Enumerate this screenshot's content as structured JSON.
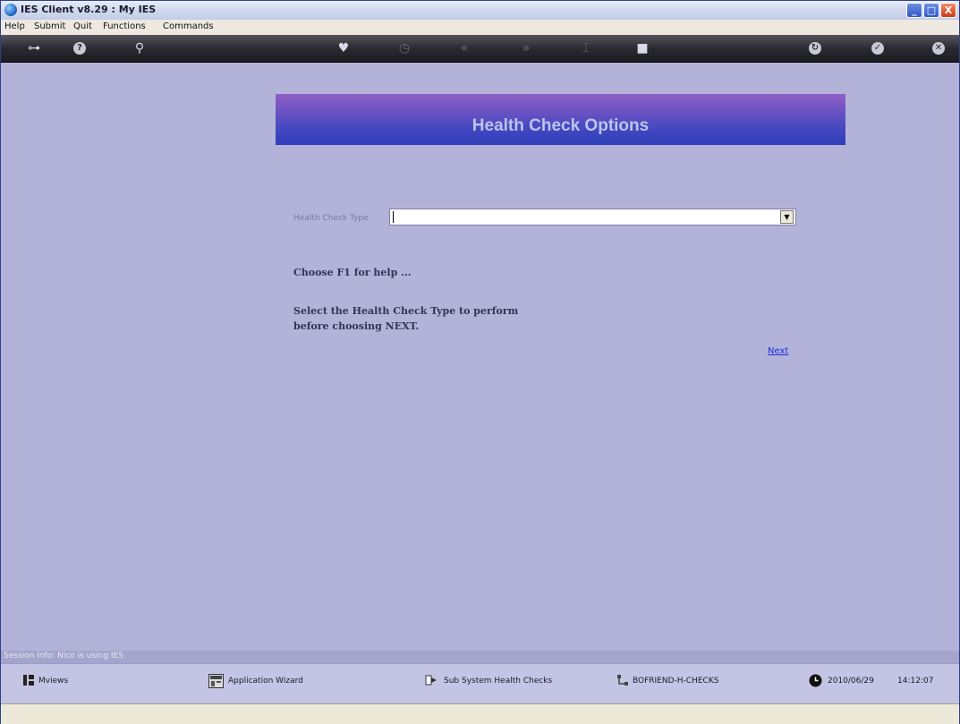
{
  "window": {
    "title": "IES Client v8.29 : My IES",
    "controls": {
      "minimize": "_",
      "maximize": "□",
      "close": "X"
    }
  },
  "menu": [
    "Help",
    "Submit",
    "Quit",
    "Functions",
    "Commands"
  ],
  "toolbar": {
    "icons": [
      "key-icon",
      "help-icon",
      "search-icon",
      "heart-icon",
      "clock-icon",
      "rewind-icon",
      "fast-forward-icon",
      "filter-icon",
      "stop-icon",
      "refresh-icon",
      "check-icon",
      "close-icon"
    ]
  },
  "header": {
    "title": "Health Check Options"
  },
  "form": {
    "field_label": "Health Check Type",
    "select_value": "",
    "help_text": "Choose F1 for help ...",
    "instruction_line1": "Select the Health Check Type to perform",
    "instruction_line2": "before choosing NEXT.",
    "next_label": "Next"
  },
  "session": {
    "info": "Session Info: Nico is using IES"
  },
  "taskbar": {
    "items": [
      {
        "label": "Mviews",
        "icon": "grid-icon"
      },
      {
        "label": "Application Wizard",
        "icon": "wizard-icon"
      },
      {
        "label": "Sub System Health Checks",
        "icon": "arrow-icon"
      },
      {
        "label": "BOFRIEND-H-CHECKS",
        "icon": "flow-icon"
      }
    ],
    "date": "2010/06/29",
    "time": "14:12:07"
  }
}
